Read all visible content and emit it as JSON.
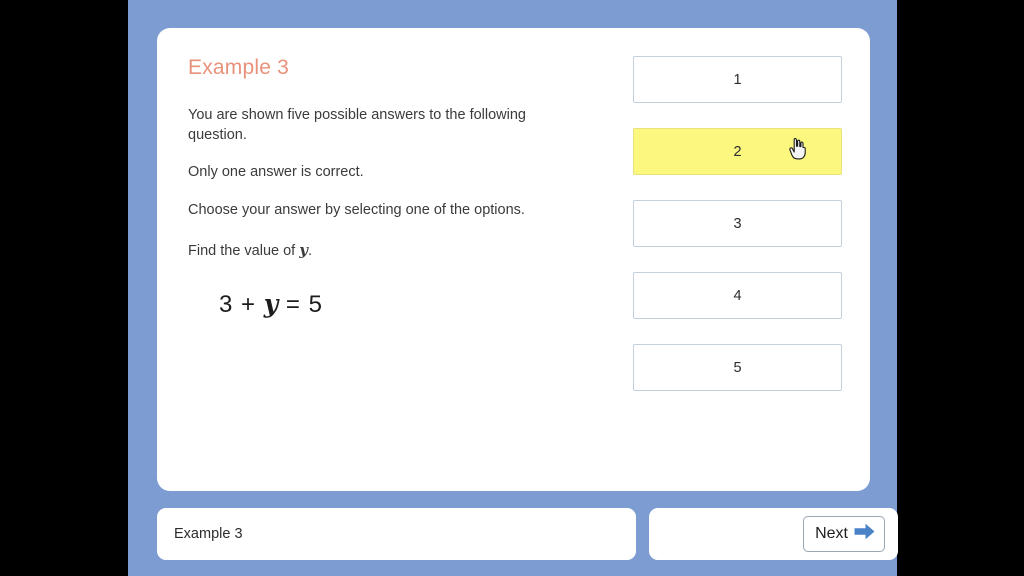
{
  "stage": {
    "background_color": "#7d9cd2",
    "letterbox_color": "#000000"
  },
  "card": {
    "title": "Example 3",
    "title_color": "#e8917b"
  },
  "question": {
    "lines": [
      "You are shown five possible answers to the following question.",
      "Only one answer is correct.",
      "Choose your answer by selecting one of the options."
    ],
    "prompt_prefix": "Find the value of ",
    "prompt_variable": "y",
    "prompt_suffix": ".",
    "equation": {
      "left_operand": "3",
      "operator": "+",
      "variable": "y",
      "equals": "=",
      "right_operand": "5",
      "full_text": "3 + y = 5"
    }
  },
  "answers": {
    "selected_index": 1,
    "selected_color": "#fbf77f",
    "border_color": "#c3d0de",
    "options": [
      {
        "label": "1",
        "selected": false
      },
      {
        "label": "2",
        "selected": true
      },
      {
        "label": "3",
        "selected": false
      },
      {
        "label": "4",
        "selected": false
      },
      {
        "label": "5",
        "selected": false
      }
    ]
  },
  "cursor": {
    "icon": "pointing-hand-cursor",
    "over_option": "2"
  },
  "bottom_bar": {
    "progress_label": "Example 3",
    "next_label": "Next",
    "next_icon": "arrow-right-icon",
    "next_icon_color": "#4a82c8"
  }
}
